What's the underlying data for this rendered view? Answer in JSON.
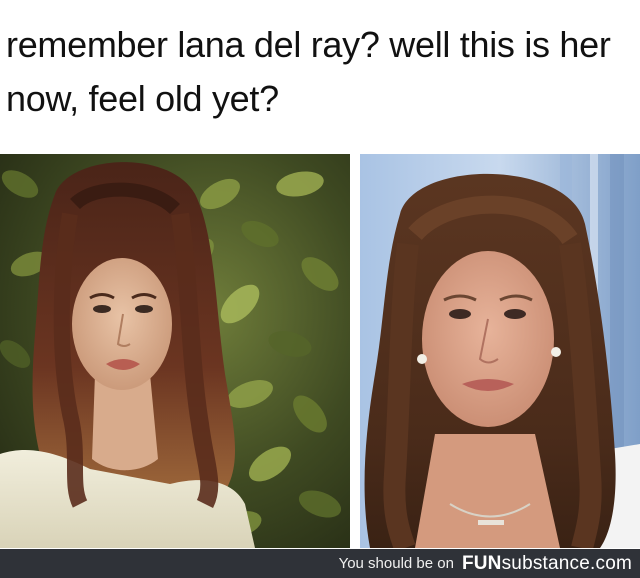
{
  "caption": {
    "line1": "remember lana del ray? well this is her",
    "line2": "now, feel old yet?"
  },
  "footer": {
    "prefix": "You should be on",
    "brand_bold": "FUN",
    "brand_rest": "substance.com"
  },
  "colors": {
    "footer_bg": "#2f3238",
    "caption_text": "#111111"
  }
}
